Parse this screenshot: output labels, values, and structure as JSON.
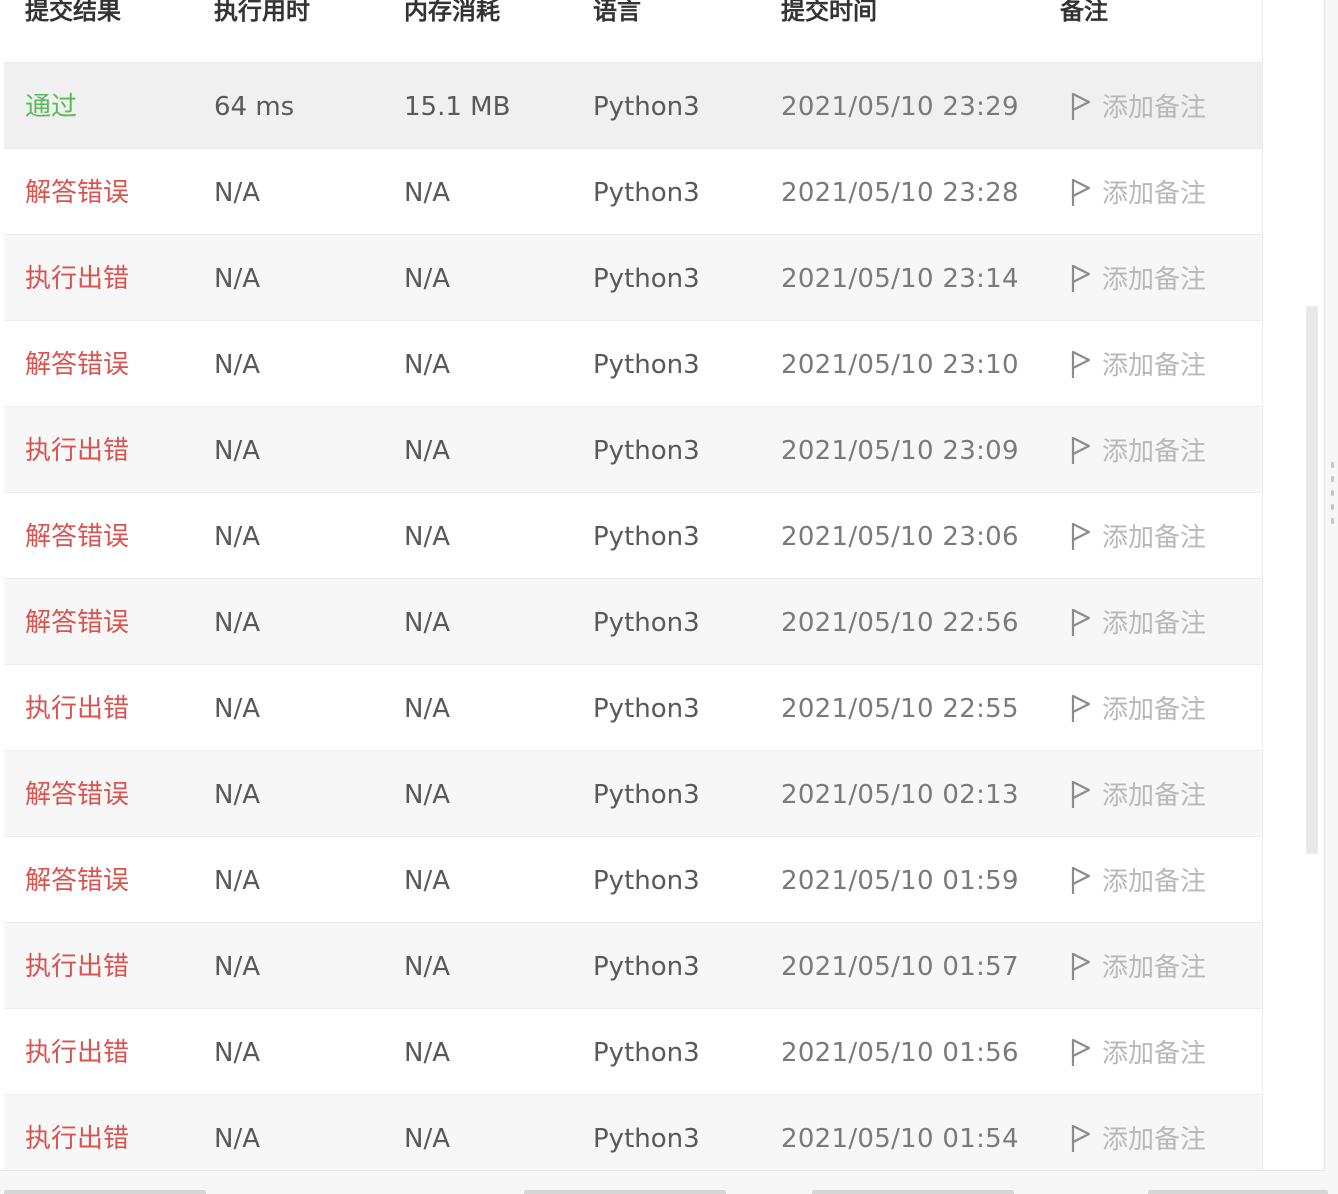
{
  "headers": {
    "result": "提交结果",
    "runtime": "执行用时",
    "memory": "内存消耗",
    "language": "语言",
    "time": "提交时间",
    "note": "备注"
  },
  "rows": [
    {
      "status": "通过",
      "status_type": "pass",
      "runtime": "64 ms",
      "memory": "15.1 MB",
      "language": "Python3",
      "time": "2021/05/10 23:29",
      "note": "添加备注"
    },
    {
      "status": "解答错误",
      "status_type": "fail",
      "runtime": "N/A",
      "memory": "N/A",
      "language": "Python3",
      "time": "2021/05/10 23:28",
      "note": "添加备注"
    },
    {
      "status": "执行出错",
      "status_type": "fail",
      "runtime": "N/A",
      "memory": "N/A",
      "language": "Python3",
      "time": "2021/05/10 23:14",
      "note": "添加备注"
    },
    {
      "status": "解答错误",
      "status_type": "fail",
      "runtime": "N/A",
      "memory": "N/A",
      "language": "Python3",
      "time": "2021/05/10 23:10",
      "note": "添加备注"
    },
    {
      "status": "执行出错",
      "status_type": "fail",
      "runtime": "N/A",
      "memory": "N/A",
      "language": "Python3",
      "time": "2021/05/10 23:09",
      "note": "添加备注"
    },
    {
      "status": "解答错误",
      "status_type": "fail",
      "runtime": "N/A",
      "memory": "N/A",
      "language": "Python3",
      "time": "2021/05/10 23:06",
      "note": "添加备注"
    },
    {
      "status": "解答错误",
      "status_type": "fail",
      "runtime": "N/A",
      "memory": "N/A",
      "language": "Python3",
      "time": "2021/05/10 22:56",
      "note": "添加备注"
    },
    {
      "status": "执行出错",
      "status_type": "fail",
      "runtime": "N/A",
      "memory": "N/A",
      "language": "Python3",
      "time": "2021/05/10 22:55",
      "note": "添加备注"
    },
    {
      "status": "解答错误",
      "status_type": "fail",
      "runtime": "N/A",
      "memory": "N/A",
      "language": "Python3",
      "time": "2021/05/10 02:13",
      "note": "添加备注"
    },
    {
      "status": "解答错误",
      "status_type": "fail",
      "runtime": "N/A",
      "memory": "N/A",
      "language": "Python3",
      "time": "2021/05/10 01:59",
      "note": "添加备注"
    },
    {
      "status": "执行出错",
      "status_type": "fail",
      "runtime": "N/A",
      "memory": "N/A",
      "language": "Python3",
      "time": "2021/05/10 01:57",
      "note": "添加备注"
    },
    {
      "status": "执行出错",
      "status_type": "fail",
      "runtime": "N/A",
      "memory": "N/A",
      "language": "Python3",
      "time": "2021/05/10 01:56",
      "note": "添加备注"
    },
    {
      "status": "执行出错",
      "status_type": "fail",
      "runtime": "N/A",
      "memory": "N/A",
      "language": "Python3",
      "time": "2021/05/10 01:54",
      "note": "添加备注"
    }
  ],
  "icons": {
    "note_icon": "flag-icon"
  },
  "colors": {
    "pass": "#5cb85c",
    "fail": "#d9534f",
    "note": "#b8b8b8"
  }
}
